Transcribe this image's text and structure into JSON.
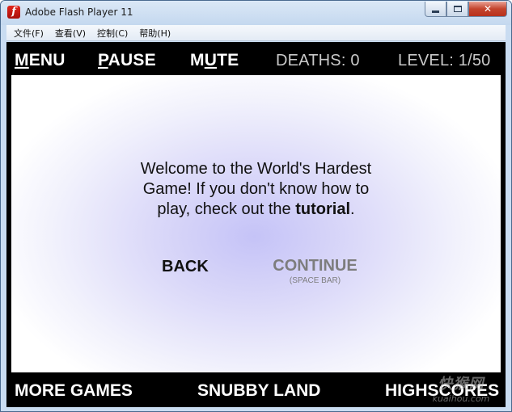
{
  "window": {
    "title": "Adobe Flash Player 11",
    "app_icon_glyph": "f",
    "controls": {
      "minimize": "minimize-icon",
      "maximize": "maximize-icon",
      "close_glyph": "✕"
    }
  },
  "menu": {
    "items": [
      {
        "label": "文件(F)"
      },
      {
        "label": "查看(V)"
      },
      {
        "label": "控制(C)"
      },
      {
        "label": "帮助(H)"
      }
    ]
  },
  "hud": {
    "menu": {
      "hot": "M",
      "rest": "ENU"
    },
    "pause": {
      "hot": "P",
      "rest": "AUSE"
    },
    "mute": {
      "pre": "M",
      "hot": "U",
      "rest": "TE"
    },
    "deaths": "DEATHS: 0",
    "level": "LEVEL: 1/50"
  },
  "screen": {
    "message_lead": "Welcome to the World's Hardest Game!  If you don't know how to play, check out the",
    "message_link": "tutorial",
    "message_end": ".",
    "back_label": "BACK",
    "continue_label": "CONTINUE",
    "continue_hint": "(SPACE BAR)"
  },
  "footer": {
    "more_games": "MORE GAMES",
    "snubby_land": "SNUBBY LAND",
    "highscores": "HIGHSCORES"
  },
  "watermark": {
    "top": "快猴网",
    "bottom": "kuaihou.com"
  },
  "colors": {
    "hud_background": "#000000",
    "hud_text": "#ffffff",
    "stat_text": "#c9c9c9",
    "playfield_glow": "#c5c3f7",
    "disabled_text": "#7d7d7d"
  }
}
